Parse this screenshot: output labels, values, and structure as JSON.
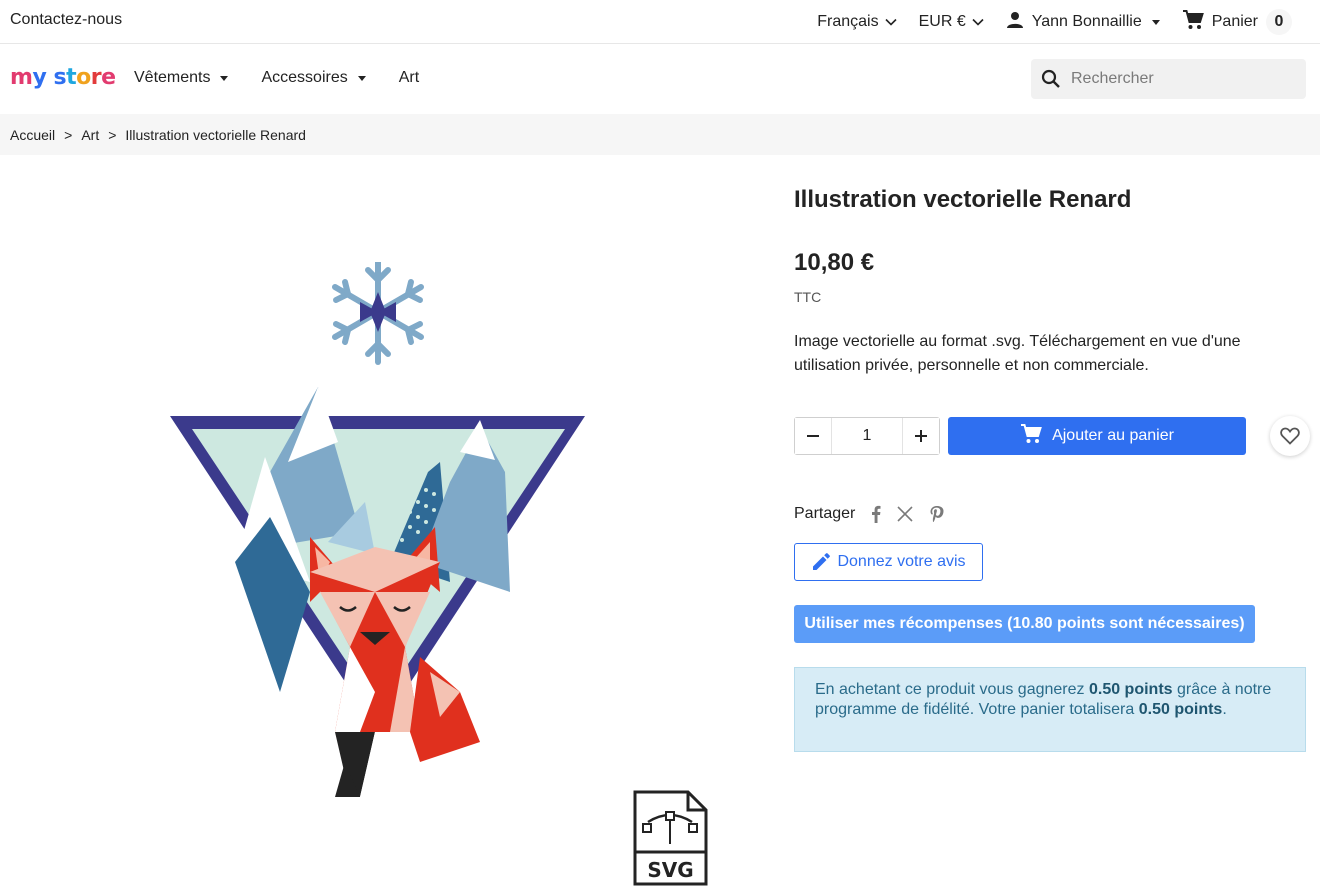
{
  "topbar": {
    "contact": "Contactez-nous",
    "language": "Français",
    "currency": "EUR €",
    "user": "Yann Bonnaillie",
    "cart_label": "Panier",
    "cart_count": "0"
  },
  "header": {
    "logo": "my store",
    "nav": [
      {
        "label": "Vêtements",
        "has_dropdown": true
      },
      {
        "label": "Accessoires",
        "has_dropdown": true
      },
      {
        "label": "Art",
        "has_dropdown": false
      }
    ],
    "search_placeholder": "Rechercher"
  },
  "breadcrumb": [
    "Accueil",
    "Art",
    "Illustration vectorielle Renard"
  ],
  "breadcrumb_sep": ">",
  "product": {
    "title": "Illustration vectorielle Renard",
    "price": "10,80 €",
    "tax_label": "TTC",
    "description": "Image vectorielle au format .svg. Téléchargement en vue d'une utilisation privée, personnelle et non commerciale.",
    "quantity": "1",
    "add_to_cart": "Ajouter au panier",
    "share_label": "Partager",
    "review_button": "Donnez votre avis",
    "rewards_button": "Utiliser mes récompenses (10.80 points sont nécessaires)",
    "loyalty": {
      "prefix": "En achetant ce produit vous gagnerez ",
      "points": "0.50 points",
      "middle": " grâce à notre programme de fidélité. Votre panier totalisera ",
      "total": "0.50 points",
      "suffix": "."
    },
    "badge_text": "SVG"
  },
  "colors": {
    "primary": "#2f6ff0",
    "rewards": "#5b9cf8",
    "loyalty_bg": "#d7ecf6",
    "breadcrumb_bg": "#f6f6f6"
  }
}
